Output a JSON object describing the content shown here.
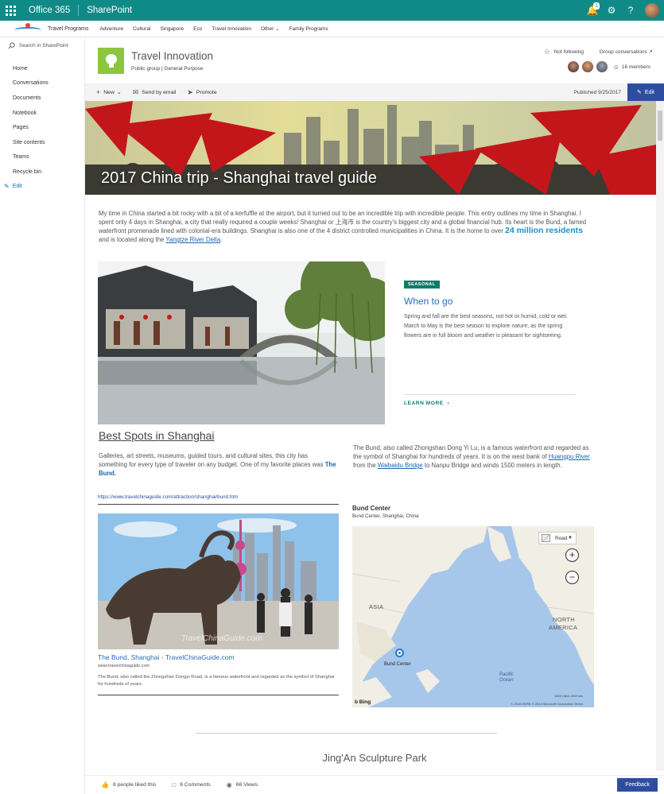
{
  "suite": {
    "app": "Office 365",
    "product": "SharePoint",
    "notifications": "1"
  },
  "hub": {
    "title": "Travel Programs",
    "items": [
      "Adventure",
      "Cultural",
      "Singapore",
      "Eco",
      "Travel Innovation",
      "Other",
      "Family Programs"
    ]
  },
  "leftnav": {
    "search_placeholder": "Search in SharePoint",
    "items": [
      "Home",
      "Conversations",
      "Documents",
      "Notebook",
      "Pages",
      "Site contents",
      "Teams",
      "Recycle bin"
    ],
    "edit": "Edit"
  },
  "site": {
    "title": "Travel Innovation",
    "subtitle": "Public group  |  General Purpose",
    "follow": "Not following",
    "group_conversations": "Group conversations ↗",
    "members": "16 members"
  },
  "commandbar": {
    "new": "New",
    "send": "Send by email",
    "promote": "Promote",
    "published": "Published 9/25/2017",
    "edit": "Edit"
  },
  "hero": {
    "title": "2017 China trip - Shanghai travel guide"
  },
  "intro": {
    "p1": "My time in China started a bit rocky with a bit of a kerfuffle at the airport, but it turned out to be an incredible trip with incredible people. This entry outlines my time in Shanghai. I spent only 4 days in Shanghai, a city that really required a couple weeks! Shanghai or 上海市 is the country's biggest city and a global financial hub. Its heart is the Bund, a famed waterfront promenade lined with colonial-era buildings. Shanghai is also one of the 4 district controlled municipalities in China. It is the home to over ",
    "big": "24 million residents",
    "p2": " and is located along the ",
    "link": "Yangtze River Delta",
    "p3": "."
  },
  "seasonal": {
    "badge": "SEASONAL",
    "title": "When to go",
    "body": "Spring and fall are the best seasons, not hot or humid, cold or wet. March to May is the best season to explore nature, as the spring flowers are in full bloom and weather is pleasant for sightseeing.",
    "learn_more": "LEARN MORE"
  },
  "best": {
    "title": "Best Spots in Shanghai",
    "body": "Galleries, art streets, museums, guided tours, and cultural sites, this city has something for every type of traveler on any budget. One of my favorite places was ",
    "link": "The Bund."
  },
  "bund": {
    "p1": "The Bund, also called Zhongshan Dong Yi Lu, is a famous waterfront and regarded as the symbol of Shanghai for hundreds of years. It is on the west bank of ",
    "link1": "Huangpu River",
    "p2": " from the ",
    "link2": "Waibaidu Bridge",
    "p3": " to Nanpu Bridge and winds 1500 meters in length."
  },
  "linkcard": {
    "url": "https://www.travelchinaguide.com/attraction/shanghai/bund.htm",
    "title": "The Bund, Shanghai - TravelChinaGuide.com",
    "site": "www.travelchinaguide.com",
    "desc": "The Bund, also called the Zhongshan Dongyi Road, is a famous waterfront and regarded as the symbol of Shanghai for hundreds of years.",
    "watermark": "TravelChinaGuide.com"
  },
  "map": {
    "title": "Bund Center",
    "subtitle": "Bund Center, Shanghai, China",
    "style": "Road",
    "labels": {
      "asia": "ASIA",
      "north_america_1": "NORTH",
      "north_america_2": "AMERICA",
      "ocean_1": "Pacific",
      "ocean_2": "Ocean"
    },
    "pin_label": "Bund Center",
    "bing": "Bing",
    "scale": "1500 miles    2000 km",
    "copyright": "© 2018 HERE © 2018 Microsoft Corporation  Terms"
  },
  "next_section": "Jing'An Sculpture Park",
  "footer": {
    "likes": "8 people liked this",
    "comments": "6 Comments",
    "views": "66 Views",
    "feedback": "Feedback"
  }
}
